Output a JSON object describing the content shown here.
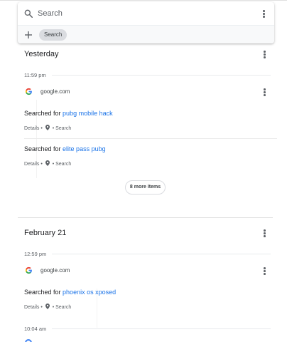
{
  "search": {
    "placeholder": "Search",
    "chip_label": "Search"
  },
  "sections": [
    {
      "title": "Yesterday",
      "time": "11:59 pm",
      "site": "google.com",
      "items": [
        {
          "prefix": "Searched for",
          "query": "pubg mobile hack",
          "details": "Details",
          "type": "Search"
        },
        {
          "prefix": "Searched for",
          "query": "elite pass pubg",
          "details": "Details",
          "type": "Search"
        }
      ],
      "more_label": "8 more items"
    },
    {
      "title": "February 21",
      "time": "12:59 pm",
      "site": "google.com",
      "items": [
        {
          "prefix": "Searched for",
          "query": "phoenix os xposed",
          "details": "Details",
          "type": "Search"
        }
      ],
      "next_time": "10:04 am"
    }
  ],
  "colors": {
    "link": "#1a73e8",
    "text": "#202124",
    "secondary": "#5f6368"
  }
}
